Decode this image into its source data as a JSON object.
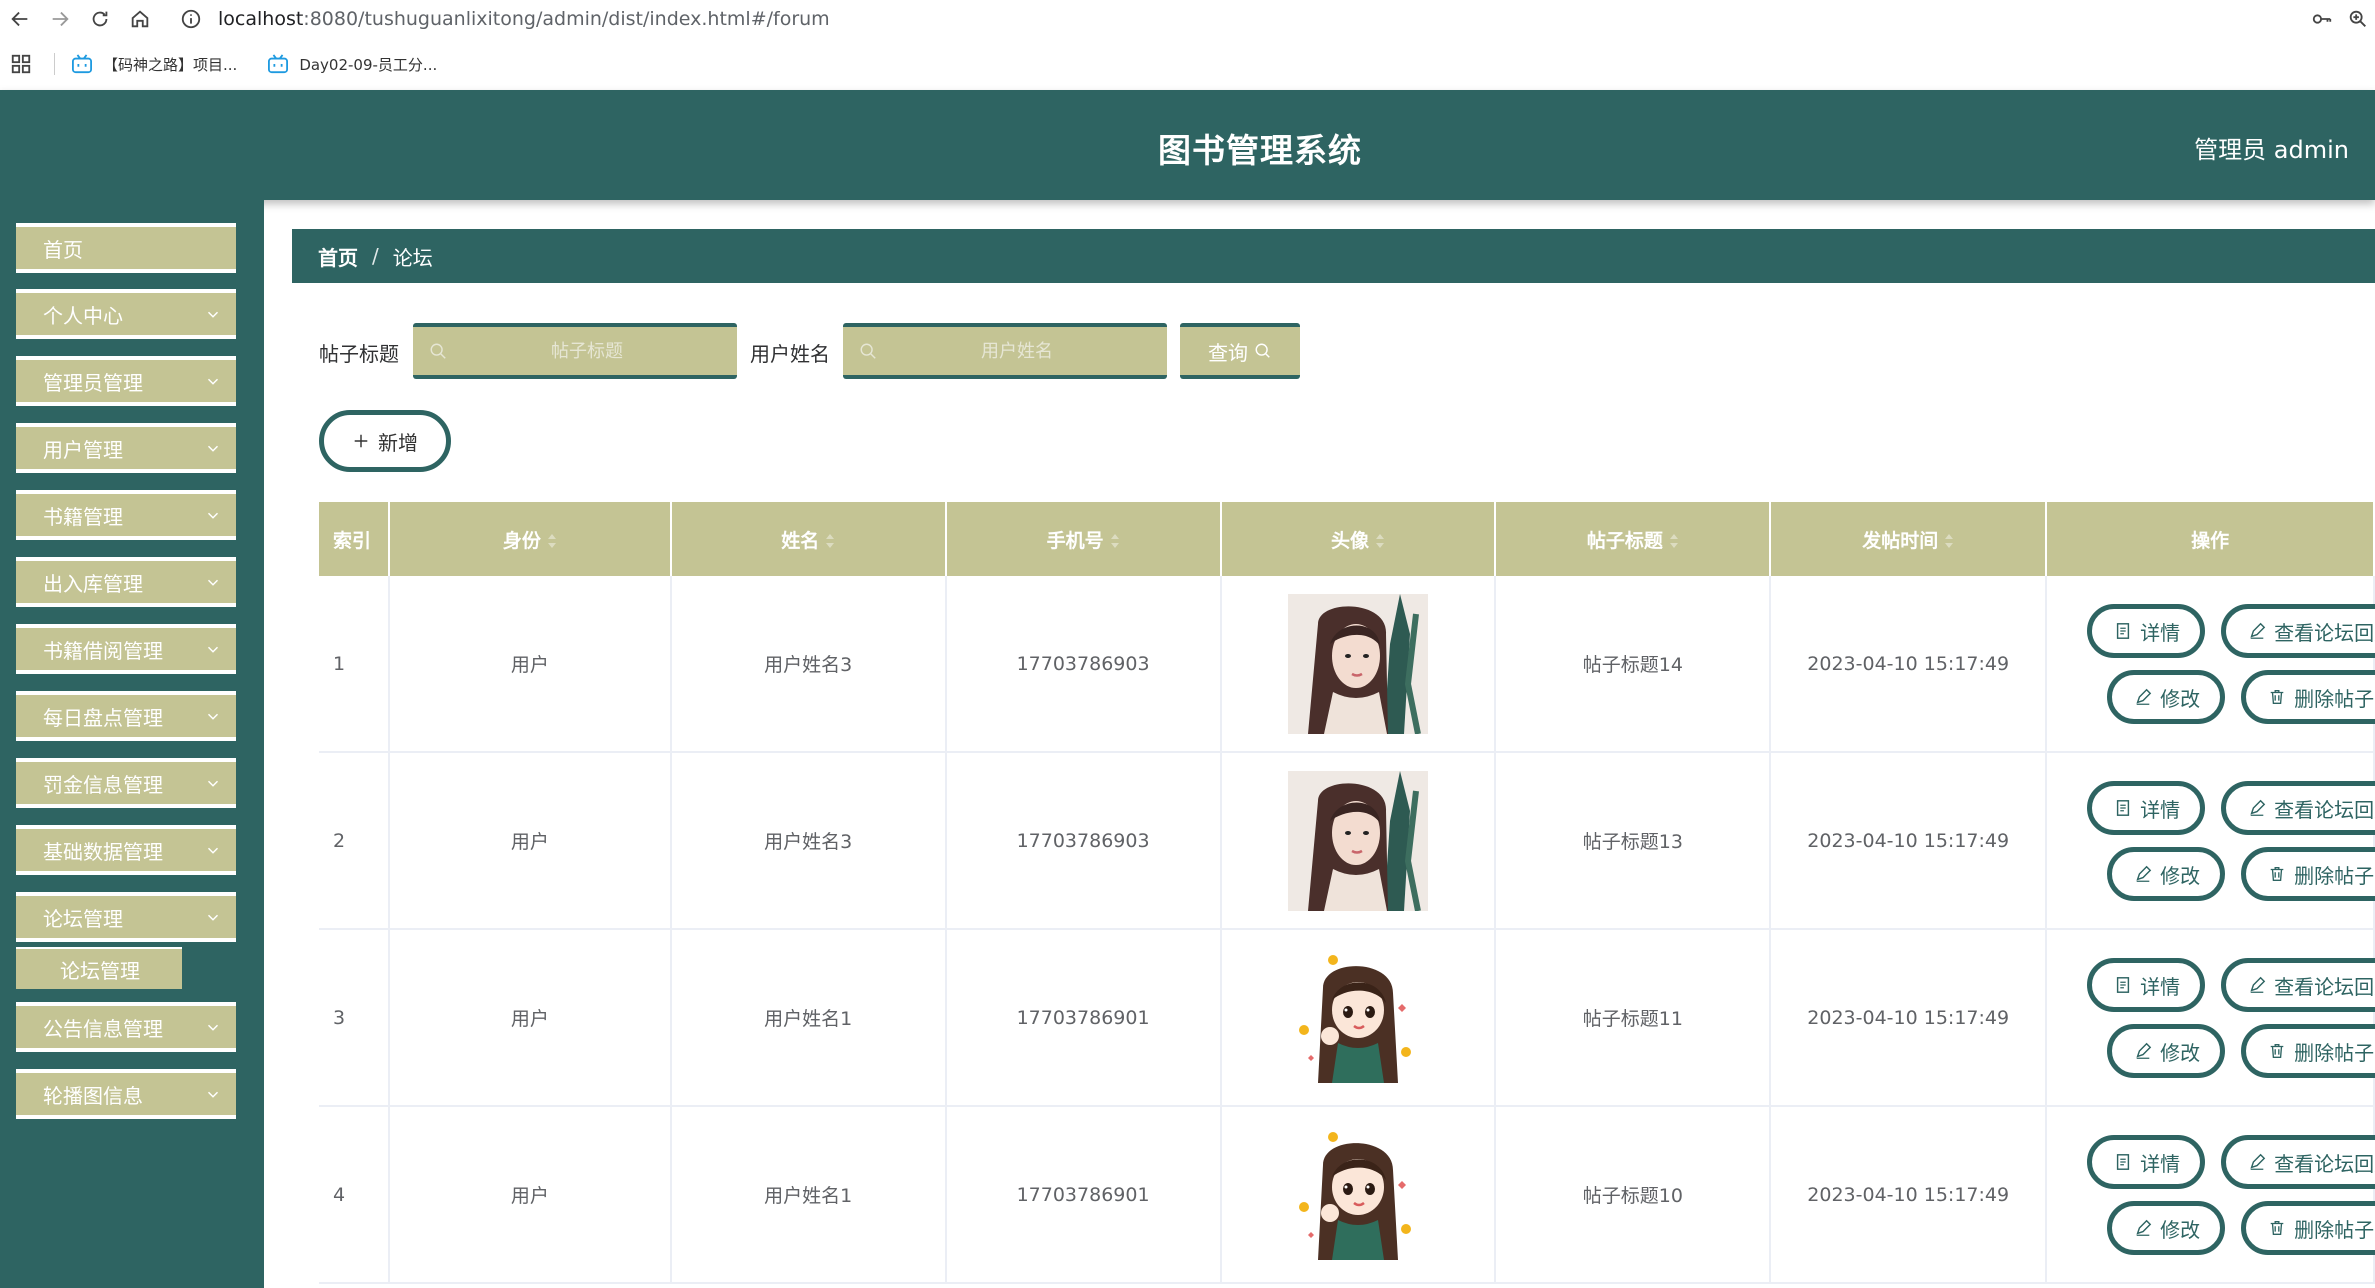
{
  "browser": {
    "url_host": "localhost",
    "url_rest": ":8080/tushuguanlixitong/admin/dist/index.html#/forum",
    "bookmarks": [
      {
        "label": "【码神之路】项目..."
      },
      {
        "label": "Day02-09-员工分..."
      }
    ]
  },
  "header": {
    "title": "图书管理系统",
    "user": "管理员 admin"
  },
  "sidebar": {
    "items": [
      {
        "label": "首页",
        "has_children": false
      },
      {
        "label": "个人中心",
        "has_children": true
      },
      {
        "label": "管理员管理",
        "has_children": true
      },
      {
        "label": "用户管理",
        "has_children": true
      },
      {
        "label": "书籍管理",
        "has_children": true
      },
      {
        "label": "出入库管理",
        "has_children": true
      },
      {
        "label": "书籍借阅管理",
        "has_children": true
      },
      {
        "label": "每日盘点管理",
        "has_children": true
      },
      {
        "label": "罚金信息管理",
        "has_children": true
      },
      {
        "label": "基础数据管理",
        "has_children": true
      },
      {
        "label": "论坛管理",
        "has_children": true
      },
      {
        "label": "公告信息管理",
        "has_children": true
      },
      {
        "label": "轮播图信息",
        "has_children": true
      }
    ],
    "active_submenu": "论坛管理"
  },
  "breadcrumb": {
    "home": "首页",
    "separator": "/",
    "current": "论坛"
  },
  "search": {
    "title_label": "帖子标题",
    "title_placeholder": "帖子标题",
    "name_label": "用户姓名",
    "name_placeholder": "用户姓名",
    "query_label": "查询"
  },
  "add_label": "新增",
  "table": {
    "columns": [
      "索引",
      "身份",
      "姓名",
      "手机号",
      "头像",
      "帖子标题",
      "发帖时间",
      "操作"
    ],
    "rows": [
      {
        "index": "1",
        "role": "用户",
        "name": "用户姓名3",
        "phone": "17703786903",
        "avatar": "avatar-woman-dark-hair",
        "title": "帖子标题14",
        "time": "2023-04-10 15:17:49"
      },
      {
        "index": "2",
        "role": "用户",
        "name": "用户姓名3",
        "phone": "17703786903",
        "avatar": "avatar-woman-dark-hair",
        "title": "帖子标题13",
        "time": "2023-04-10 15:17:49"
      },
      {
        "index": "3",
        "role": "用户",
        "name": "用户姓名1",
        "phone": "17703786901",
        "avatar": "avatar-cartoon-girl",
        "title": "帖子标题11",
        "time": "2023-04-10 15:17:49"
      },
      {
        "index": "4",
        "role": "用户",
        "name": "用户姓名1",
        "phone": "17703786901",
        "avatar": "avatar-cartoon-girl",
        "title": "帖子标题10",
        "time": "2023-04-10 15:17:49"
      }
    ],
    "actions": {
      "detail": "详情",
      "view_replies": "查看论坛回复",
      "edit": "修改",
      "delete": "删除帖子"
    }
  },
  "colors": {
    "primary": "#2e6462",
    "accent": "#c4c494"
  }
}
